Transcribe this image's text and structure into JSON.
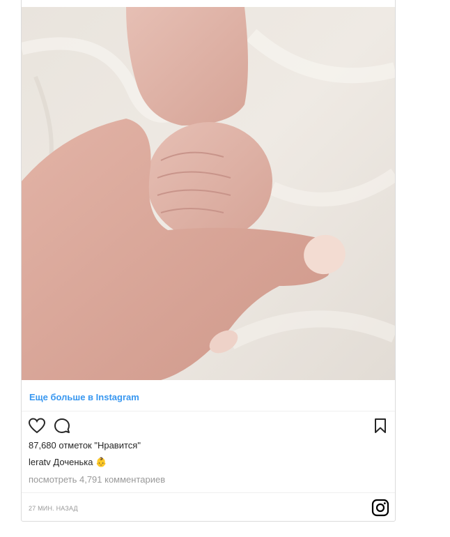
{
  "post": {
    "more_link": "Еще больше в Instagram",
    "likes": "87,680 отметок \"Нравится\"",
    "username": "leratv",
    "caption_text": "Доченька",
    "caption_emoji": "👶",
    "comments_link": "посмотреть 4,791 комментариев",
    "timestamp": "27 МИН. НАЗАД"
  },
  "icons": {
    "like": "heart-icon",
    "comment": "comment-icon",
    "save": "bookmark-icon",
    "brand": "instagram-icon"
  },
  "colors": {
    "link": "#3897f0",
    "text": "#262626",
    "muted": "#999999",
    "border": "#dbdbdb"
  }
}
